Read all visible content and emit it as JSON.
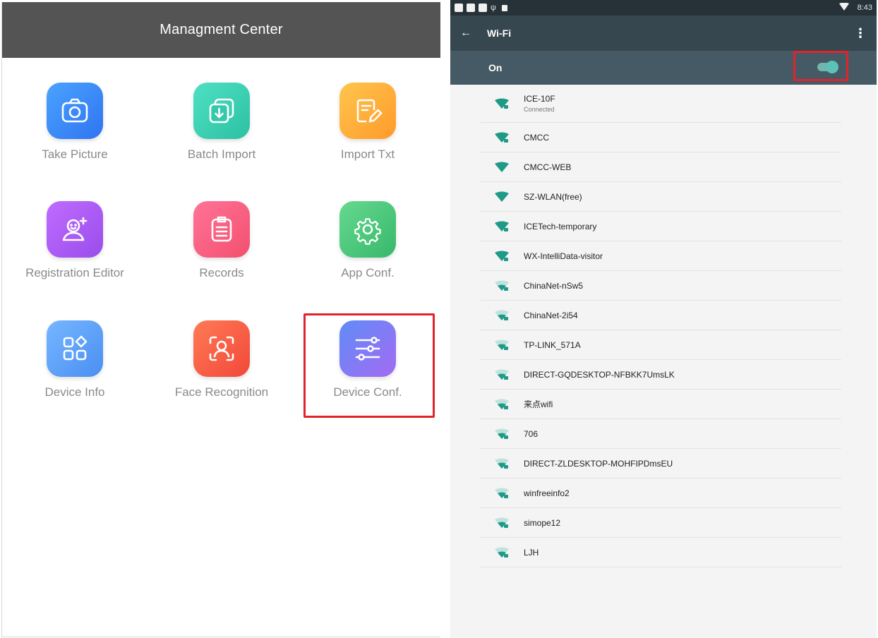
{
  "left": {
    "header_title": "Managment Center",
    "tiles": [
      {
        "label": "Take Picture",
        "icon": "camera-icon",
        "color": "#3d8bf7"
      },
      {
        "label": "Batch Import",
        "icon": "batch-import-icon",
        "color": "#3ccfb1"
      },
      {
        "label": "Import Txt",
        "icon": "import-txt-icon",
        "color": "#ffb03a"
      },
      {
        "label": "Registration Editor",
        "icon": "user-add-icon",
        "color": "#a85df2"
      },
      {
        "label": "Records",
        "icon": "records-icon",
        "color": "#f86184"
      },
      {
        "label": "App Conf.",
        "icon": "gear-icon",
        "color": "#4fc67f"
      },
      {
        "label": "Device Info",
        "icon": "grid-icon",
        "color": "#5aa2f8"
      },
      {
        "label": "Face Recognition",
        "icon": "face-scan-icon",
        "color": "#fb6345"
      },
      {
        "label": "Device Conf.",
        "icon": "sliders-icon",
        "color": "#7a74f4"
      }
    ]
  },
  "right": {
    "status_time": "8:43",
    "appbar_title": "Wi-Fi",
    "toggle_label": "On",
    "toggle_state": "on",
    "networks": [
      {
        "name": "ICE-10F",
        "status": "Connected"
      },
      {
        "name": "CMCC"
      },
      {
        "name": "CMCC-WEB"
      },
      {
        "name": "SZ-WLAN(free)"
      },
      {
        "name": "ICETech-temporary"
      },
      {
        "name": "WX-IntelliData-visitor"
      },
      {
        "name": "ChinaNet-nSw5"
      },
      {
        "name": "ChinaNet-2i54"
      },
      {
        "name": "TP-LINK_571A"
      },
      {
        "name": "DIRECT-GQDESKTOP-NFBKK7UmsLK"
      },
      {
        "name": "来点wifi"
      },
      {
        "name": "706"
      },
      {
        "name": "DIRECT-ZLDESKTOP-MOHFIPDmsEU"
      },
      {
        "name": "winfreeinfo2"
      },
      {
        "name": "simope12"
      },
      {
        "name": "LJH"
      }
    ]
  }
}
